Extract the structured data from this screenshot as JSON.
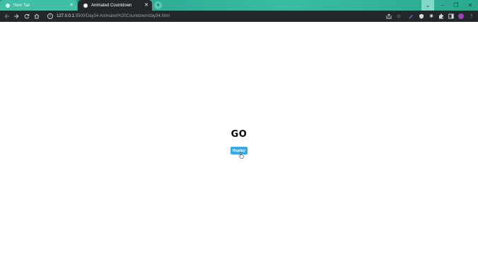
{
  "browser": {
    "tabs": [
      {
        "title": "New Tab",
        "active": false
      },
      {
        "title": "Animated Countdown",
        "active": true
      }
    ],
    "close_glyph": "✕",
    "new_tab_glyph": "+",
    "window_controls": {
      "list": "⌄",
      "minimize": "–",
      "maximize": "❐",
      "close": "✕"
    },
    "address": {
      "host": "127.0.0.1",
      "path": ":5500/Day34-Animated%20Countdown/day34.html"
    },
    "accent_color": "#2fae98"
  },
  "page": {
    "countdown_text": "GO",
    "replay_label": "Replay",
    "button_color": "#3aa7e6"
  }
}
